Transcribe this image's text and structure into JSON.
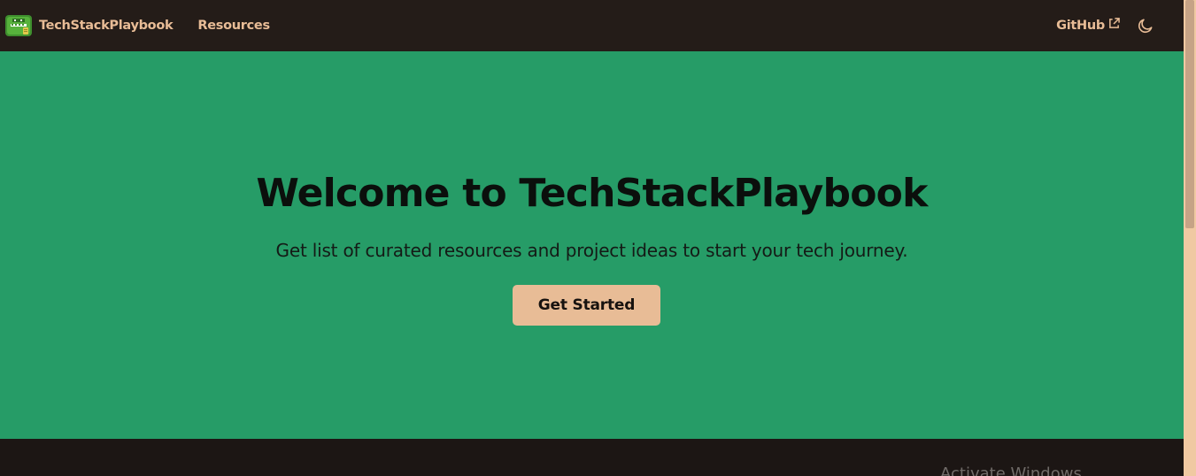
{
  "navbar": {
    "brand_title": "TechStackPlaybook",
    "logo_icon": "crocodile-logo-icon",
    "links": [
      {
        "label": "Resources"
      }
    ],
    "github_label": "GitHub",
    "external_icon": "external-link-icon",
    "theme_icon": "moon-icon"
  },
  "hero": {
    "title": "Welcome to TechStackPlaybook",
    "subtitle": "Get list of curated resources and project ideas to start your tech journey.",
    "cta_label": "Get Started"
  },
  "overlay": {
    "watermark": "Activate Windows"
  },
  "colors": {
    "nav_bg": "#241c18",
    "accent": "#e8bc96",
    "hero_bg": "#269c67",
    "footer_bg": "#1c1614"
  }
}
